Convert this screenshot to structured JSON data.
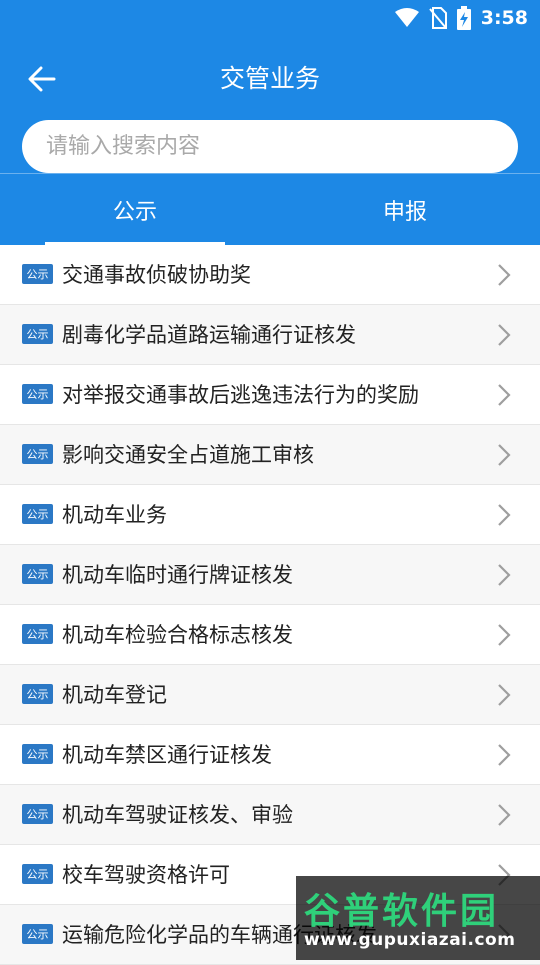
{
  "status_bar": {
    "time": "3:58"
  },
  "header": {
    "title": "交管业务",
    "back_icon": "arrow-left-icon",
    "search_placeholder": "请输入搜索内容"
  },
  "tabs": [
    {
      "label": "公示",
      "active": true
    },
    {
      "label": "申报",
      "active": false
    }
  ],
  "colors": {
    "primary": "#1d88e5",
    "badge": "#2b78c5"
  },
  "badge_label": "公示",
  "items": [
    {
      "label": "交通事故侦破协助奖"
    },
    {
      "label": "剧毒化学品道路运输通行证核发"
    },
    {
      "label": "对举报交通事故后逃逸违法行为的奖励"
    },
    {
      "label": "影响交通安全占道施工审核"
    },
    {
      "label": "机动车业务"
    },
    {
      "label": "机动车临时通行牌证核发"
    },
    {
      "label": "机动车检验合格标志核发"
    },
    {
      "label": "机动车登记"
    },
    {
      "label": "机动车禁区通行证核发"
    },
    {
      "label": "机动车驾驶证核发、审验"
    },
    {
      "label": "校车驾驶资格许可"
    },
    {
      "label": "运输危险化学品的车辆通行证核发"
    }
  ],
  "watermark": {
    "title": "谷普软件园",
    "url": "www.gupuxiazai.com"
  }
}
